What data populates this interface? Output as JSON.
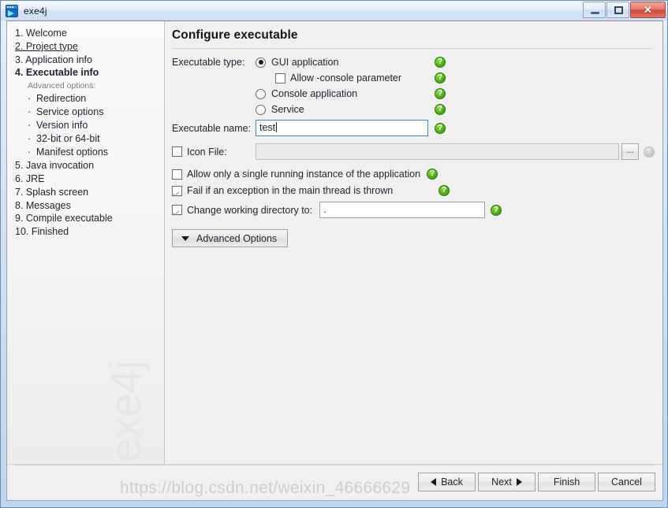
{
  "window": {
    "title": "exe4j",
    "app_icon": "exe4j-app-icon",
    "minimize_label": "–",
    "maximize_label": "□",
    "close_label": "✕"
  },
  "sidebar": {
    "watermark": "exe4j",
    "items": [
      {
        "label": "1. Welcome",
        "state": "normal"
      },
      {
        "label": "2. Project type",
        "state": "visited"
      },
      {
        "label": "3. Application info",
        "state": "normal"
      },
      {
        "label": "4. Executable info",
        "state": "active"
      }
    ],
    "sub_header": "Advanced options:",
    "sub_items": [
      {
        "bullet": "·",
        "label": "Redirection"
      },
      {
        "bullet": "·",
        "label": "Service options"
      },
      {
        "bullet": "·",
        "label": "Version info"
      },
      {
        "bullet": "·",
        "label": "32-bit or 64-bit"
      },
      {
        "bullet": "·",
        "label": "Manifest options"
      }
    ],
    "items_after": [
      {
        "label": "5. Java invocation",
        "state": "normal"
      },
      {
        "label": "6. JRE",
        "state": "normal"
      },
      {
        "label": "7. Splash screen",
        "state": "normal"
      },
      {
        "label": "8. Messages",
        "state": "normal"
      },
      {
        "label": "9. Compile executable",
        "state": "normal"
      },
      {
        "label": "10. Finished",
        "state": "normal"
      }
    ]
  },
  "main": {
    "title": "Configure executable",
    "executable_type_label": "Executable type:",
    "options": {
      "gui_application": {
        "label": "GUI application",
        "selected": true
      },
      "allow_console_parameter": {
        "label": "Allow -console parameter",
        "checked": false
      },
      "console_application": {
        "label": "Console application",
        "selected": false
      },
      "service": {
        "label": "Service",
        "selected": false
      }
    },
    "executable_name": {
      "label": "Executable name:",
      "value": "test",
      "focused": true
    },
    "icon_file": {
      "label": "Icon File:",
      "checked": false,
      "value": "",
      "browse_label": "...",
      "help_disabled": true
    },
    "single_instance": {
      "label": "Allow only a single running instance of the application",
      "checked": false
    },
    "fail_on_exception": {
      "label": "Fail if an exception in the main thread is thrown",
      "checked": true
    },
    "change_working_dir": {
      "label": "Change working directory to:",
      "checked": true,
      "value": "."
    },
    "advanced_options_button": "Advanced Options",
    "help_icon": "?"
  },
  "footer": {
    "buttons": [
      {
        "label": "Back",
        "icon": "triangle-left-icon"
      },
      {
        "label": "Next",
        "icon": "triangle-right-icon"
      },
      {
        "label": "Finish",
        "icon": ""
      },
      {
        "label": "Cancel",
        "icon": ""
      }
    ]
  },
  "overlay": {
    "url_watermark": "https://blog.csdn.net/weixin_46666629"
  },
  "colors": {
    "help_green": "#5db81f",
    "focus_blue": "#3c87c8",
    "close_red": "#cf4b3b",
    "frame_blue": "#a8c4e6"
  }
}
